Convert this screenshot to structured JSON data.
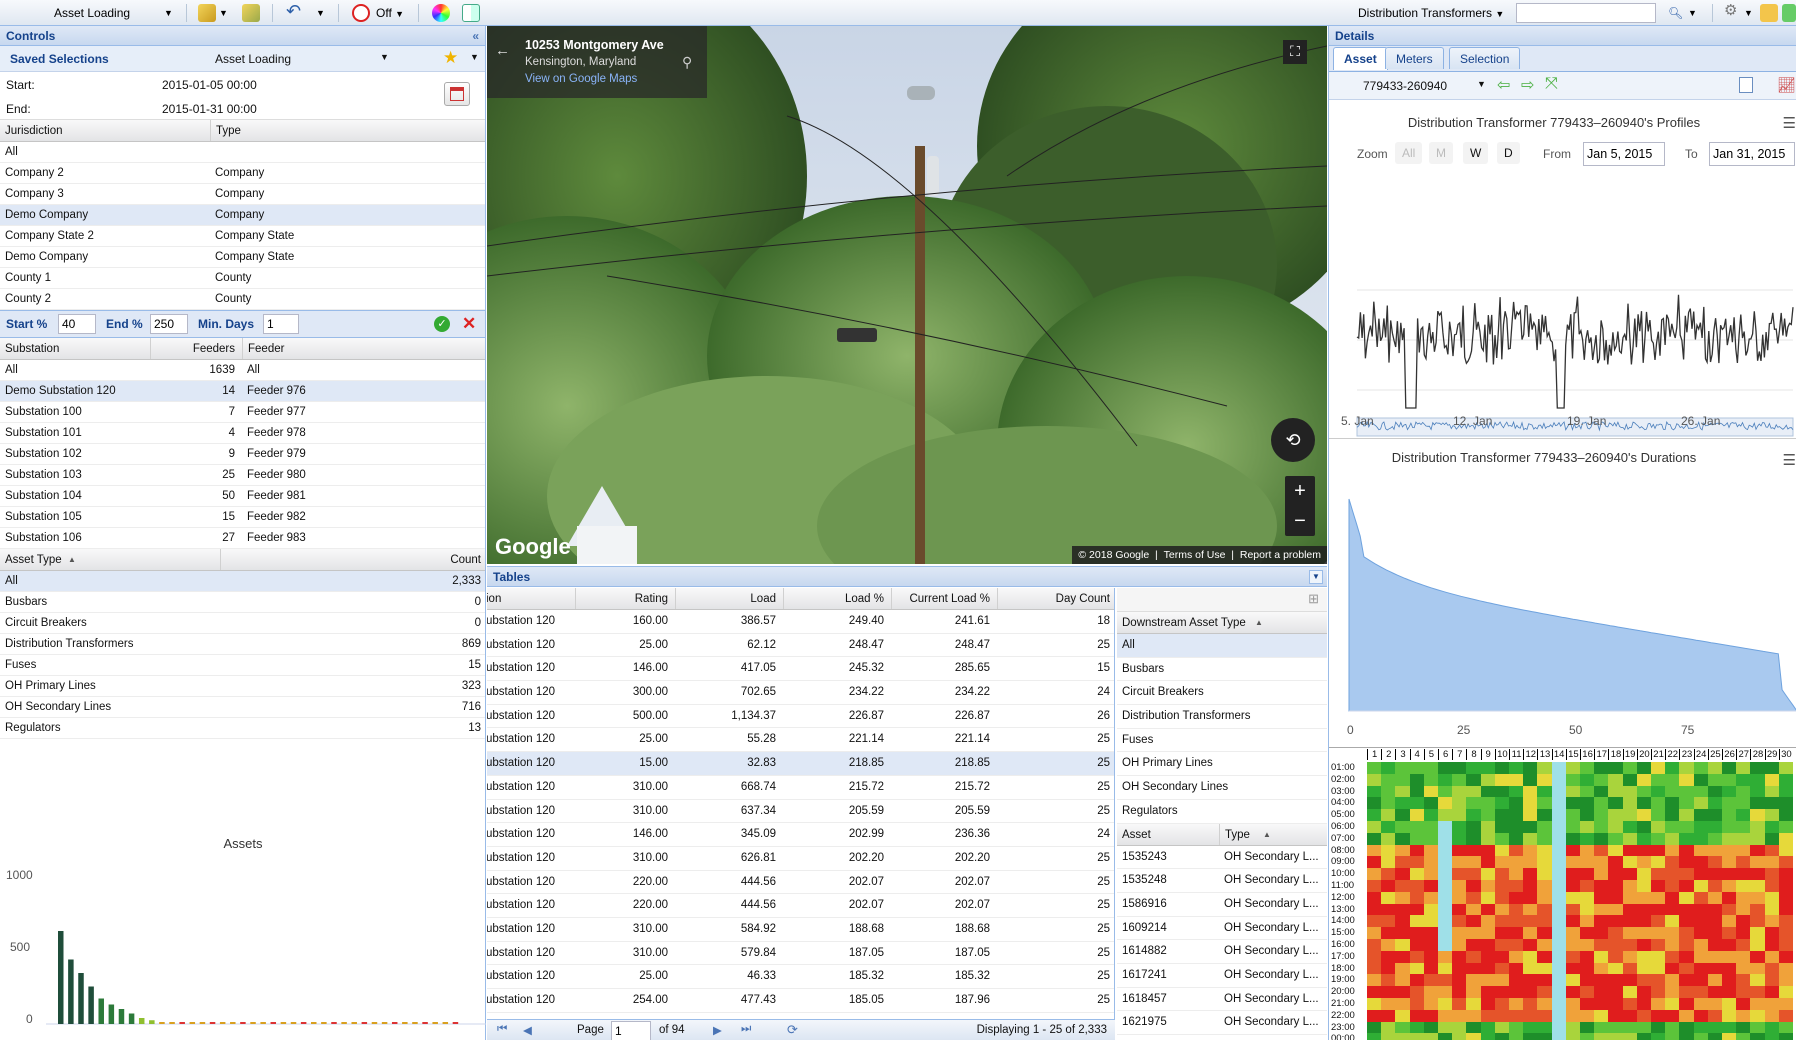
{
  "toolbar": {
    "view_select": "Asset Loading",
    "off_label": "Off",
    "asset_layer_select": "Distribution Transformers",
    "search_placeholder": ""
  },
  "controls": {
    "title": "Controls",
    "saved_selections_label": "Saved Selections",
    "saved_selection_value": "Asset Loading",
    "start_label": "Start:",
    "start_value": "2015-01-05 00:00",
    "end_label": "End:",
    "end_value": "2015-01-31 00:00",
    "jurisdiction": {
      "columns": [
        "Jurisdiction",
        "Type"
      ],
      "rows": [
        [
          "All",
          ""
        ],
        [
          "Company 2",
          "Company"
        ],
        [
          "Company 3",
          "Company"
        ],
        [
          "Demo Company",
          "Company"
        ],
        [
          "Company State 2",
          "Company State"
        ],
        [
          "Demo Company",
          "Company State"
        ],
        [
          "County 1",
          "County"
        ],
        [
          "County 2",
          "County"
        ]
      ],
      "selected_index": 3
    },
    "filters": {
      "start_pct_label": "Start %",
      "start_pct_value": "40",
      "end_pct_label": "End %",
      "end_pct_value": "250",
      "min_days_label": "Min. Days",
      "min_days_value": "1"
    },
    "substation": {
      "columns": [
        "Substation",
        "Feeders",
        "Feeder"
      ],
      "rows": [
        [
          "All",
          "1639",
          "All"
        ],
        [
          "Demo Substation 120",
          "14",
          "Feeder 976"
        ],
        [
          "Substation 100",
          "7",
          "Feeder 977"
        ],
        [
          "Substation 101",
          "4",
          "Feeder 978"
        ],
        [
          "Substation 102",
          "9",
          "Feeder 979"
        ],
        [
          "Substation 103",
          "25",
          "Feeder 980"
        ],
        [
          "Substation 104",
          "50",
          "Feeder 981"
        ],
        [
          "Substation 105",
          "15",
          "Feeder 982"
        ],
        [
          "Substation 106",
          "27",
          "Feeder 983"
        ]
      ],
      "selected_index": 1
    },
    "asset_types": {
      "columns": [
        "Asset Type",
        "Count"
      ],
      "rows": [
        [
          "All",
          "2,333"
        ],
        [
          "Busbars",
          "0"
        ],
        [
          "Circuit Breakers",
          "0"
        ],
        [
          "Distribution Transformers",
          "869"
        ],
        [
          "Fuses",
          "15"
        ],
        [
          "OH Primary Lines",
          "323"
        ],
        [
          "OH Secondary Lines",
          "716"
        ],
        [
          "Regulators",
          "13"
        ]
      ],
      "selected_index": 0
    },
    "assets_chart": {
      "title": "Assets",
      "y_ticks": [
        "1000",
        "500",
        "0"
      ]
    }
  },
  "chart_data": [
    {
      "type": "bar",
      "title": "Assets",
      "ylim": [
        0,
        1000
      ],
      "values": [
        620,
        430,
        340,
        250,
        170,
        130,
        100,
        70,
        40,
        25,
        12,
        10,
        8,
        8,
        7,
        7,
        6,
        6,
        6,
        6,
        5,
        5,
        5,
        5,
        5,
        5,
        5,
        5,
        5,
        5,
        5,
        5,
        5,
        5,
        5,
        5,
        5,
        5,
        5,
        5
      ]
    },
    {
      "type": "line",
      "title": "Distribution Transformer 779433-260940's Profiles",
      "x_ticks": [
        "5. Jan",
        "12. Jan",
        "19. Jan",
        "26. Jan"
      ]
    },
    {
      "type": "area",
      "title": "Distribution Transformer 779433-260940's Durations",
      "x_ticks": [
        "0",
        "25",
        "50",
        "75"
      ]
    }
  ],
  "map": {
    "address": "10253 Montgomery Ave",
    "locality": "Kensington, Maryland",
    "maps_link": "View on Google Maps",
    "google_logo": "Google",
    "copyright": "© 2018 Google",
    "terms": "Terms of Use",
    "report": "Report a problem"
  },
  "tables": {
    "title": "Tables",
    "columns": [
      "ion",
      "Rating",
      "Load",
      "Load %",
      "Current Load %",
      "Day Count"
    ],
    "rows": [
      [
        "ubstation 120",
        "160.00",
        "386.57",
        "249.40",
        "241.61",
        "18"
      ],
      [
        "ubstation 120",
        "25.00",
        "62.12",
        "248.47",
        "248.47",
        "25"
      ],
      [
        "ubstation 120",
        "146.00",
        "417.05",
        "245.32",
        "285.65",
        "15"
      ],
      [
        "ubstation 120",
        "300.00",
        "702.65",
        "234.22",
        "234.22",
        "24"
      ],
      [
        "ubstation 120",
        "500.00",
        "1,134.37",
        "226.87",
        "226.87",
        "26"
      ],
      [
        "ubstation 120",
        "25.00",
        "55.28",
        "221.14",
        "221.14",
        "25"
      ],
      [
        "ubstation 120",
        "15.00",
        "32.83",
        "218.85",
        "218.85",
        "25"
      ],
      [
        "ubstation 120",
        "310.00",
        "668.74",
        "215.72",
        "215.72",
        "25"
      ],
      [
        "ubstation 120",
        "310.00",
        "637.34",
        "205.59",
        "205.59",
        "25"
      ],
      [
        "ubstation 120",
        "146.00",
        "345.09",
        "202.99",
        "236.36",
        "24"
      ],
      [
        "ubstation 120",
        "310.00",
        "626.81",
        "202.20",
        "202.20",
        "25"
      ],
      [
        "ubstation 120",
        "220.00",
        "444.56",
        "202.07",
        "202.07",
        "25"
      ],
      [
        "ubstation 120",
        "220.00",
        "444.56",
        "202.07",
        "202.07",
        "25"
      ],
      [
        "ubstation 120",
        "310.00",
        "584.92",
        "188.68",
        "188.68",
        "25"
      ],
      [
        "ubstation 120",
        "310.00",
        "579.84",
        "187.05",
        "187.05",
        "25"
      ],
      [
        "ubstation 120",
        "25.00",
        "46.33",
        "185.32",
        "185.32",
        "25"
      ],
      [
        "ubstation 120",
        "254.00",
        "477.43",
        "185.05",
        "187.96",
        "25"
      ]
    ],
    "selected_index": 6,
    "pager": {
      "page_label": "Page",
      "page_value": "1",
      "of_label": "of 94",
      "displaying": "Displaying 1 - 25 of 2,333"
    },
    "downstream": {
      "column": "Downstream Asset Type",
      "rows": [
        "All",
        "Busbars",
        "Circuit Breakers",
        "Distribution Transformers",
        "Fuses",
        "OH Primary Lines",
        "OH Secondary Lines",
        "Regulators"
      ],
      "selected_index": 0
    },
    "asset_list": {
      "columns": [
        "Asset",
        "Type"
      ],
      "rows": [
        [
          "1535243",
          "OH Secondary L..."
        ],
        [
          "1535248",
          "OH Secondary L..."
        ],
        [
          "1586916",
          "OH Secondary L..."
        ],
        [
          "1609214",
          "OH Secondary L..."
        ],
        [
          "1614882",
          "OH Secondary L..."
        ],
        [
          "1617241",
          "OH Secondary L..."
        ],
        [
          "1618457",
          "OH Secondary L..."
        ],
        [
          "1621975",
          "OH Secondary L..."
        ]
      ]
    }
  },
  "details": {
    "title": "Details",
    "tabs": [
      "Asset",
      "Meters",
      "Selection"
    ],
    "active_tab": 0,
    "asset_id": "779433-260940",
    "profiles_title": "Distribution Transformer 779433–260940's Profiles",
    "zoom_label": "Zoom",
    "zoom_buttons": [
      "All",
      "M",
      "W",
      "D"
    ],
    "from_label": "From",
    "from_value": "Jan 5, 2015",
    "to_label": "To",
    "to_value": "Jan 31, 2015",
    "profile_x_ticks": [
      "5. Jan",
      "12. Jan",
      "19. Jan",
      "26. Jan"
    ],
    "navigator_ticks": [
      "5. Jan",
      "19. Jan"
    ],
    "durations_title": "Distribution Transformer 779433–260940's Durations",
    "duration_x_ticks": [
      "0",
      "25",
      "50",
      "75"
    ],
    "heatmap_days": [
      "1",
      "2",
      "3",
      "4",
      "5",
      "6",
      "7",
      "8",
      "9",
      "10",
      "11",
      "12",
      "13",
      "14",
      "15",
      "16",
      "17",
      "18",
      "19",
      "20",
      "21",
      "22",
      "23",
      "24",
      "25",
      "26",
      "27",
      "28",
      "29",
      "30"
    ],
    "heatmap_hours": [
      "01:00",
      "02:00",
      "03:00",
      "04:00",
      "05:00",
      "06:00",
      "07:00",
      "08:00",
      "09:00",
      "10:00",
      "11:00",
      "12:00",
      "13:00",
      "14:00",
      "15:00",
      "16:00",
      "17:00",
      "18:00",
      "19:00",
      "20:00",
      "21:00",
      "22:00",
      "23:00",
      "00:00"
    ]
  },
  "colors": {
    "panel_header": "#c7d8ef",
    "accent": "#15428b",
    "selection": "#dfe8f6",
    "chart_fill": "#a9c9ef",
    "heat_high": "#e11d1d",
    "heat_low": "#1e9e2e",
    "heat_missing": "#9fe0e8"
  }
}
